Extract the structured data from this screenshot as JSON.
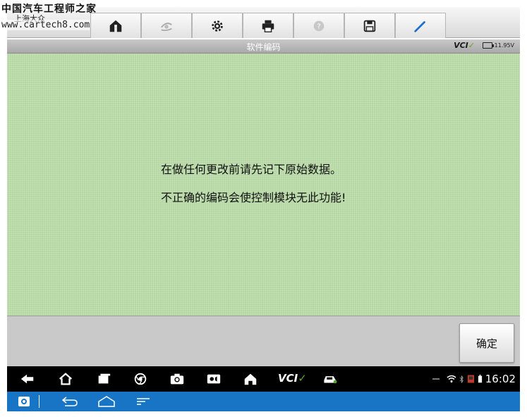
{
  "watermark": {
    "line1": "中国汽车工程师之家",
    "line2": "www.cartech8.com"
  },
  "toolbar": {
    "brand_label": "上海大众",
    "tabs": [
      {
        "icon": "home-icon"
      },
      {
        "icon": "vehicle-swap-icon"
      },
      {
        "icon": "gear-icon"
      },
      {
        "icon": "printer-icon"
      },
      {
        "icon": "help-icon"
      },
      {
        "icon": "save-icon"
      },
      {
        "icon": "pen-icon"
      }
    ]
  },
  "titlebar": {
    "title": "软件编码",
    "vci_label": "VCI",
    "voltage": "11.95V"
  },
  "content": {
    "message_line1": "在做任何更改前请先记下原始数据。",
    "message_line2": "不正确的编码会使控制模块无此功能!"
  },
  "actionbar": {
    "confirm_label": "确定"
  },
  "navbar": {
    "vci_label": "VCI",
    "clock": "16:02"
  },
  "colors": {
    "content_bg": "#b5d7a3",
    "system_bar": "#1874c4",
    "vci_accent": "#5aa52c"
  }
}
